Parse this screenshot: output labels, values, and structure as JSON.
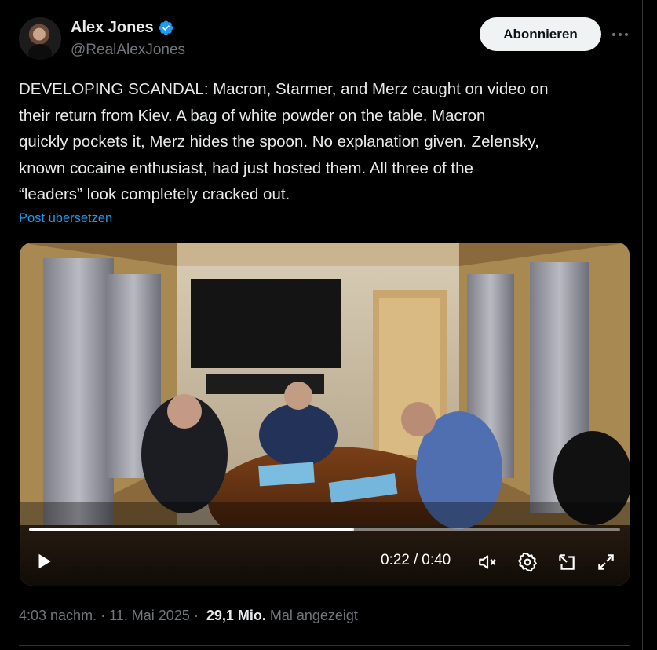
{
  "author": {
    "name": "Alex Jones",
    "handle": "@RealAlexJones",
    "verified_icon": "verified-badge-icon"
  },
  "actions": {
    "follow_label": "Abonnieren",
    "more_icon": "more-icon"
  },
  "post": {
    "text": "DEVELOPING SCANDAL: Macron, Starmer, and Merz caught on video on\ntheir return from Kiev. A bag of white powder on the table. Macron\nquickly pockets it, Merz hides the spoon. No explanation given. Zelensky,\nknown cocaine enthusiast, had just hosted them. All three of the\n“leaders” look completely cracked out.",
    "translate_label": "Post übersetzen"
  },
  "video": {
    "current_time": "0:22",
    "separator": "/",
    "duration": "0:40",
    "progress_fraction": 0.55,
    "icons": [
      "play-icon",
      "mute-icon",
      "settings-icon",
      "pip-icon",
      "fullscreen-icon"
    ]
  },
  "meta": {
    "time": "4:03 nachm.",
    "sep1": "·",
    "date": "11. Mai 2025",
    "sep2": "·",
    "views": "29,1 Mio.",
    "views_suffix": "Mal angezeigt"
  },
  "colors": {
    "background": "#000000",
    "text": "#e7e9ea",
    "muted": "#71767b",
    "link": "#1d9bf0",
    "verified": "#1d9bf0",
    "follow_bg": "#eff3f4"
  }
}
